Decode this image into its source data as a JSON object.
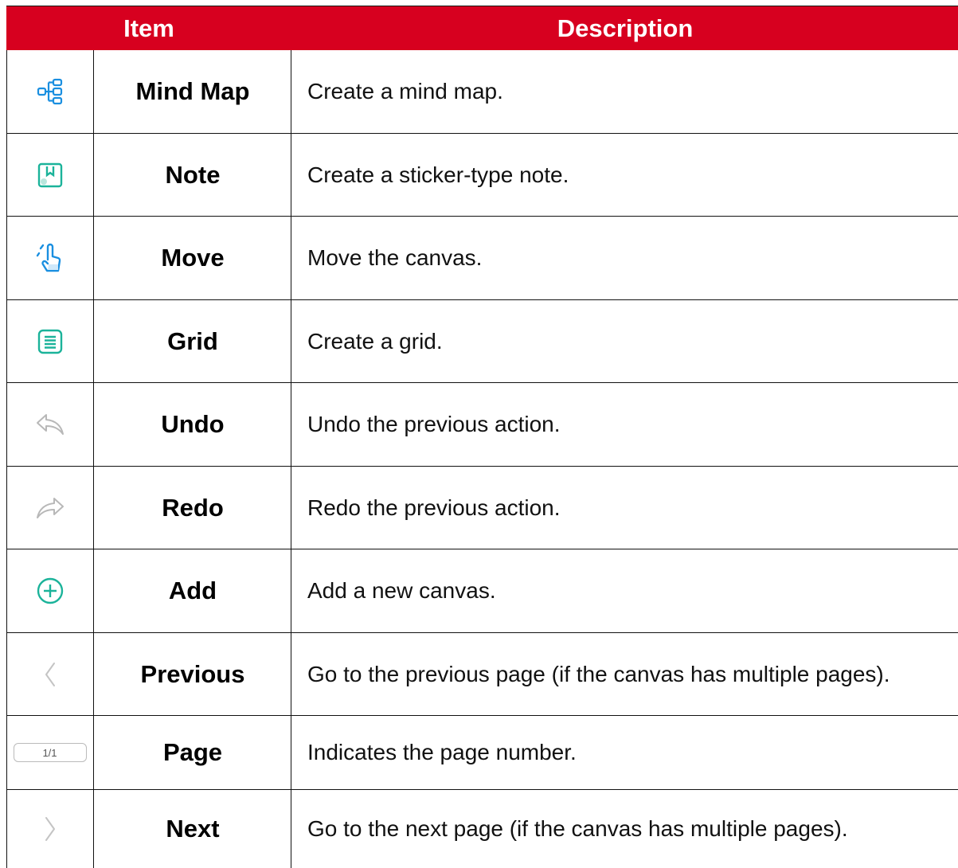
{
  "header": {
    "item": "Item",
    "description": "Description"
  },
  "rows": [
    {
      "icon": "mind-map-icon",
      "name": "Mind Map",
      "desc": "Create a mind map."
    },
    {
      "icon": "note-icon",
      "name": "Note",
      "desc": "Create a sticker-type note."
    },
    {
      "icon": "move-hand-icon",
      "name": "Move",
      "desc": "Move the canvas."
    },
    {
      "icon": "grid-icon",
      "name": "Grid",
      "desc": "Create a grid."
    },
    {
      "icon": "undo-icon",
      "name": "Undo",
      "desc": "Undo the previous action."
    },
    {
      "icon": "redo-icon",
      "name": "Redo",
      "desc": "Redo the previous action."
    },
    {
      "icon": "add-circle-icon",
      "name": "Add",
      "desc": "Add a new canvas."
    },
    {
      "icon": "chevron-left-icon",
      "name": "Previous",
      "desc": "Go to the previous page (if the canvas has multiple pages)."
    },
    {
      "icon": "page-indicator",
      "name": "Page",
      "desc": "Indicates the page number.",
      "page_text": "1/1"
    },
    {
      "icon": "chevron-right-icon",
      "name": "Next",
      "desc": "Go to the next page (if the canvas has multiple pages)."
    }
  ],
  "colors": {
    "header_bg": "#d7001f",
    "icon_blue": "#1a8fe0",
    "icon_teal": "#1bb39a",
    "icon_gray": "#b8b8b8"
  }
}
